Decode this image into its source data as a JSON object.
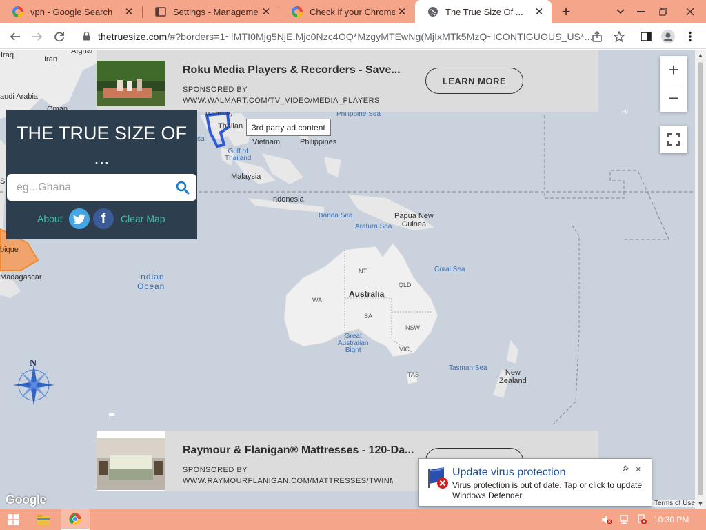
{
  "browser": {
    "tabs": [
      {
        "title": "vpn - Google Search",
        "icon": "google-icon",
        "active": false
      },
      {
        "title": "Settings - Management",
        "icon": "settings-page-icon",
        "active": false
      },
      {
        "title": "Check if your Chrome br",
        "icon": "google-icon",
        "active": false
      },
      {
        "title": "The True Size Of ...",
        "icon": "globe-icon",
        "active": true
      }
    ],
    "new_tab_label": "+",
    "address": {
      "host": "thetruesize.com",
      "path": "/#?borders=1~!MTI0Mjg5NjE.Mjc0Nzc4OQ*MzgyMTEwNg(MjIxMTk5MzQ~!CONTIGUOUS_US*..."
    }
  },
  "app": {
    "title": "THE TRUE SIZE OF ...",
    "search": {
      "placeholder": "eg...Ghana",
      "value": ""
    },
    "about_label": "About",
    "clear_map_label": "Clear Map",
    "twitter_glyph": "t",
    "facebook_glyph": "f"
  },
  "ads": [
    {
      "title": "Roku Media Players & Recorders - Save...",
      "sponsor_label": "SPONSORED BY",
      "url": "WWW.WALMART.COM/TV_VIDEO/MEDIA_PLAYERS",
      "cta": "LEARN MORE"
    },
    {
      "title": "Raymour & Flanigan® Mattresses - 120-Da...",
      "sponsor_label": "SPONSORED BY",
      "url": "WWW.RAYMOURFLANIGAN.COM/MATTRESSES/TWINMA",
      "cta": ""
    }
  ],
  "tooltip": "3rd party ad content",
  "map": {
    "labels": {
      "iraq": "Iraq",
      "iran": "Iran",
      "afghan": "Afghar",
      "saudi": "audi Arabia",
      "oman": "Oman",
      "thailand": "Thailan",
      "burma": "(Burma)",
      "vietnam": "Vietnam",
      "philippines": "Philippines",
      "philippine_sea": "Philippine Sea",
      "gulf_thailand": "Gulf of\nThailand",
      "malaysia": "Malaysia",
      "indonesia": "Indonesia",
      "banda_sea": "Banda Sea",
      "arafura_sea": "Arafura Sea",
      "png": "Papua New\nGuinea",
      "coral_sea": "Coral Sea",
      "indian_ocean": "Indian\nOcean",
      "australia": "Australia",
      "nt": "NT",
      "qld": "QLD",
      "wa": "WA",
      "sa": "SA",
      "nsw": "NSW",
      "vic": "VIC",
      "tas": "TAS",
      "gab": "Great\nAustralian\nBight",
      "tasman_sea": "Tasman Sea",
      "new_zealand": "New\nZealand",
      "mozambique": "bique",
      "madagascar": "Madagascar",
      "hi": "HI",
      "sea_trunc": "sal",
      "s_trunc": "S"
    },
    "compass_letter": "N",
    "zoom_in": "+",
    "zoom_out": "−",
    "google": "Google",
    "terms": "Terms of Use"
  },
  "notification": {
    "title": "Update virus protection",
    "body": "Virus protection is out of date. Tap or click to update Windows Defender.",
    "close": "×"
  },
  "taskbar": {
    "clock": "10:30 PM"
  },
  "colors": {
    "tab_strip": "#f4a58a",
    "panel": "#2d3e4f",
    "accent_teal": "#40c0a5",
    "map_water": "#c9d2dd",
    "notification_title": "#1c4fa0"
  }
}
